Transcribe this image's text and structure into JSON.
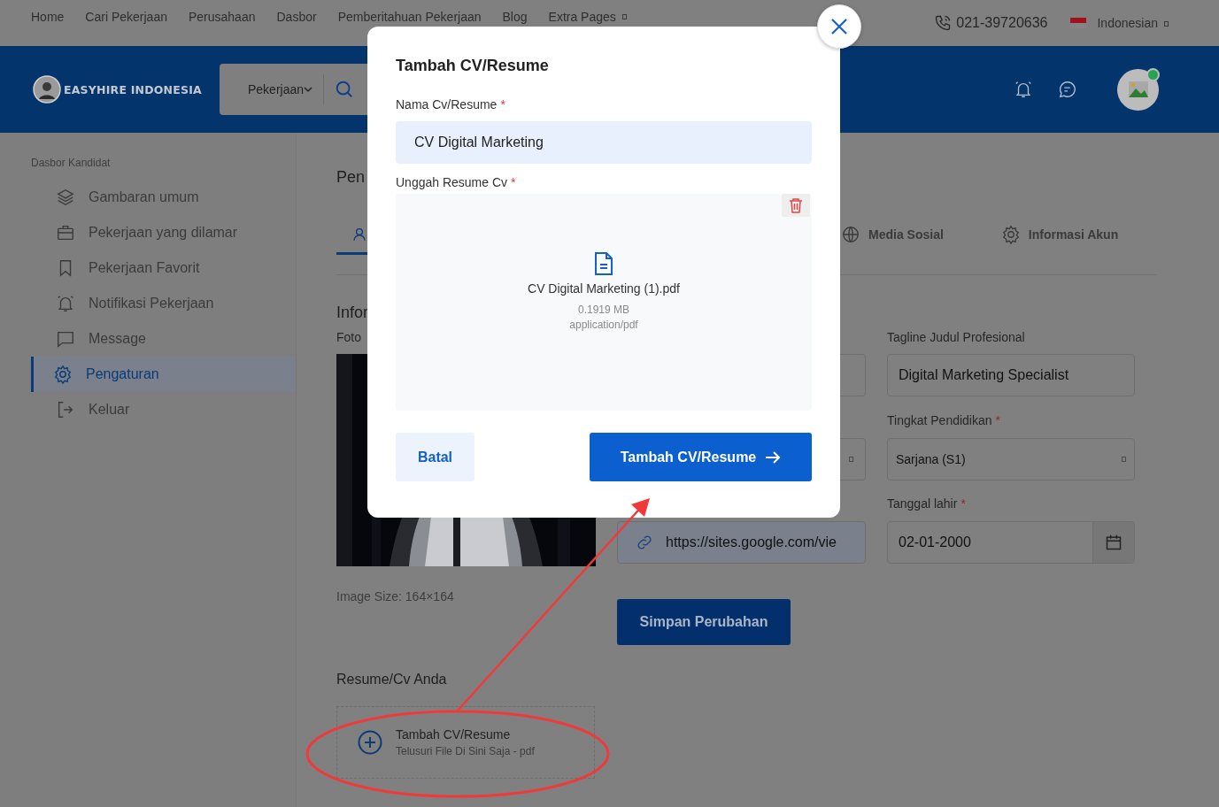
{
  "top_nav": {
    "links": [
      {
        "label": "Home"
      },
      {
        "label": "Cari Pekerjaan"
      },
      {
        "label": "Perusahaan"
      },
      {
        "label": "Dasbor"
      },
      {
        "label": "Pemberitahuan Pekerjaan"
      },
      {
        "label": "Blog"
      },
      {
        "label": "Extra Pages",
        "kind": "dropdown"
      }
    ],
    "phone": "021-39720636",
    "language": "Indonesian"
  },
  "header": {
    "logo_text": "EASYHIRE INDONESIA",
    "search_category": "Pekerjaan"
  },
  "sidebar": {
    "title": "Dasbor Kandidat",
    "items": [
      {
        "label": "Gambaran umum",
        "selected": false
      },
      {
        "label": "Pekerjaan yang dilamar",
        "selected": false
      },
      {
        "label": "Pekerjaan Favorit",
        "selected": false
      },
      {
        "label": "Notifikasi Pekerjaan",
        "selected": false
      },
      {
        "label": "Message",
        "selected": false
      },
      {
        "label": "Pengaturan",
        "selected": true
      },
      {
        "label": "Keluar",
        "selected": false
      }
    ]
  },
  "main": {
    "heading": "Pen",
    "tabs": [
      {
        "selected": true
      },
      {
        "label": "Media Sosial",
        "selected": false
      },
      {
        "label": "Informasi Akun",
        "selected": false
      }
    ],
    "section_title": "Infor",
    "photo_label": "Foto",
    "image_size": "Image Size: 164×164",
    "resume_title": "Resume/Cv Anda",
    "add_resume": {
      "title": "Tambah CV/Resume",
      "hint": "Telusuri File Di Sini Saja - pdf"
    },
    "website_value": "https://sites.google.com/vie",
    "save_button": "Simpan Perubahan",
    "tagline": {
      "label": "Tagline Judul Profesional",
      "value": "Digital Marketing Specialist"
    },
    "education": {
      "label": "Tingkat Pendidikan",
      "mark": "*",
      "value": "Sarjana (S1)"
    },
    "birth_date": {
      "label": "Tanggal lahir",
      "mark": "*",
      "value": "02-01-2000"
    }
  },
  "modal": {
    "title": "Tambah CV/Resume",
    "name_field": {
      "label": "Nama Cv/Resume",
      "mark": "*",
      "value": "CV Digital Marketing"
    },
    "upload": {
      "label": "Unggah Resume Cv",
      "mark": "*",
      "file_name": "CV Digital Marketing (1).pdf",
      "file_size": "0.1919 MB",
      "file_type": "application/pdf"
    },
    "buttons": [
      {
        "label": "Batal",
        "kind": "secondary"
      },
      {
        "label": "Tambah CV/Resume",
        "kind": "primary"
      }
    ]
  }
}
